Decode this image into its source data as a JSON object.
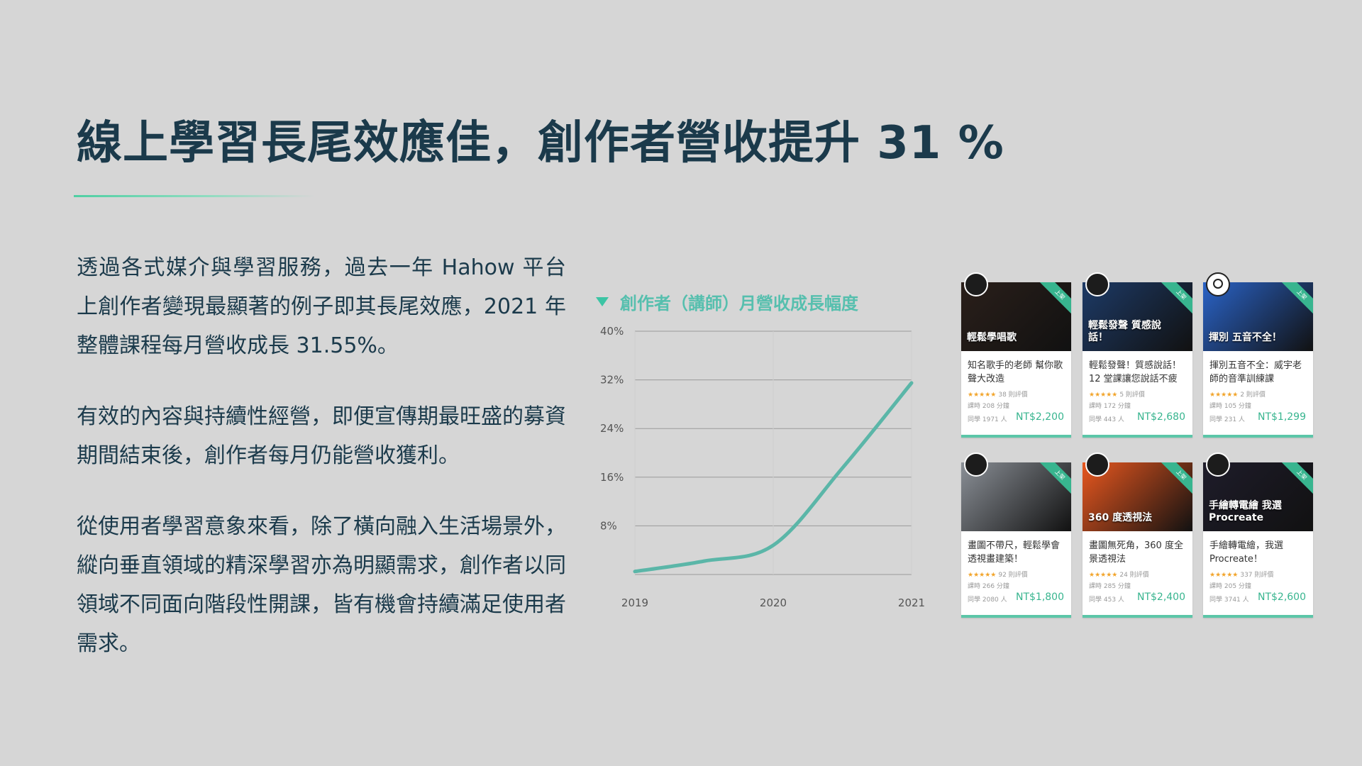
{
  "slide": {
    "title": "線上學習長尾效應佳，創作者營收提升 31 %",
    "paragraphs": [
      "透過各式媒介與學習服務，過去一年 Hahow 平台上創作者變現最顯著的例子即其長尾效應，2021 年整體課程每月營收成長 31.55%。",
      "有效的內容與持續性經營，即便宣傳期最旺盛的募資期間結束後，創作者每月仍能營收獲利。",
      "從使用者學習意象來看，除了橫向融入生活場景外，縱向垂直領域的精深學習亦為明顯需求，創作者以同領域不同面向階段性開課，皆有機會持續滿足使用者需求。"
    ]
  },
  "chart_data": {
    "type": "line",
    "title": "創作者（講師）月營收成長幅度",
    "x": [
      "2019",
      "2020",
      "2021"
    ],
    "x_numeric": [
      2019,
      2019.5,
      2020,
      2020.5,
      2021
    ],
    "series": [
      {
        "values": [
          0.5,
          2.2,
          4.8,
          17.5,
          31.5
        ]
      }
    ],
    "y_ticks": [
      "8%",
      "16%",
      "24%",
      "32%",
      "40%"
    ],
    "ylim": [
      0,
      40
    ],
    "grid": true,
    "line_color": "#5bb6a8"
  },
  "courses": [
    {
      "thumb_text": "輕鬆學唱歌",
      "thumb_bg": "#2a1f1a",
      "avatar": "dark",
      "ribbon": "上架",
      "title": "知名歌手的老師 幫你歌聲大改造",
      "stars": "★★★★★",
      "reviews": "38 則評價",
      "duration": "課時 208 分鐘",
      "students": "同學 1971 人",
      "price": "NT$2,200"
    },
    {
      "thumb_text": "輕鬆發聲 質感說話！",
      "thumb_bg": "#1d3a66",
      "avatar": "dark",
      "ribbon": "上架",
      "title": "輕鬆發聲！質感說話！12 堂課讓您說話不疲",
      "stars": "★★★★★",
      "reviews": "5 則評價",
      "duration": "課時 172 分鐘",
      "students": "同學 443 人",
      "price": "NT$2,680"
    },
    {
      "thumb_text": "揮別 五音不全！",
      "thumb_bg": "#2a63c7",
      "avatar": "white",
      "ribbon": "上架",
      "title": "揮別五音不全：威宇老師的音準訓練課",
      "stars": "★★★★★",
      "reviews": "2 則評價",
      "duration": "課時 105 分鐘",
      "students": "同學 231 人",
      "price": "NT$1,299"
    },
    {
      "thumb_text": "",
      "thumb_bg": "#8a8f96",
      "avatar": "dark",
      "ribbon": "上架",
      "title": "畫圖不帶尺，輕鬆學會透視畫建築！",
      "stars": "★★★★★",
      "reviews": "92 則評價",
      "duration": "課時 266 分鐘",
      "students": "同學 2080 人",
      "price": "NT$1,800"
    },
    {
      "thumb_text": "360 度透視法",
      "thumb_bg": "#e8571f",
      "avatar": "dark",
      "ribbon": "上架",
      "title": "畫圖無死角，360 度全景透視法",
      "stars": "★★★★★",
      "reviews": "24 則評價",
      "duration": "課時 285 分鐘",
      "students": "同學 453 人",
      "price": "NT$2,400"
    },
    {
      "thumb_text": "手繪轉電繪 我選Procreate",
      "thumb_bg": "#1e1c2a",
      "avatar": "dark",
      "ribbon": "上架",
      "title": "手繪轉電繪，我選 Procreate！",
      "stars": "★★★★★",
      "reviews": "337 則評價",
      "duration": "課時 205 分鐘",
      "students": "同學 3741 人",
      "price": "NT$2,600"
    }
  ]
}
